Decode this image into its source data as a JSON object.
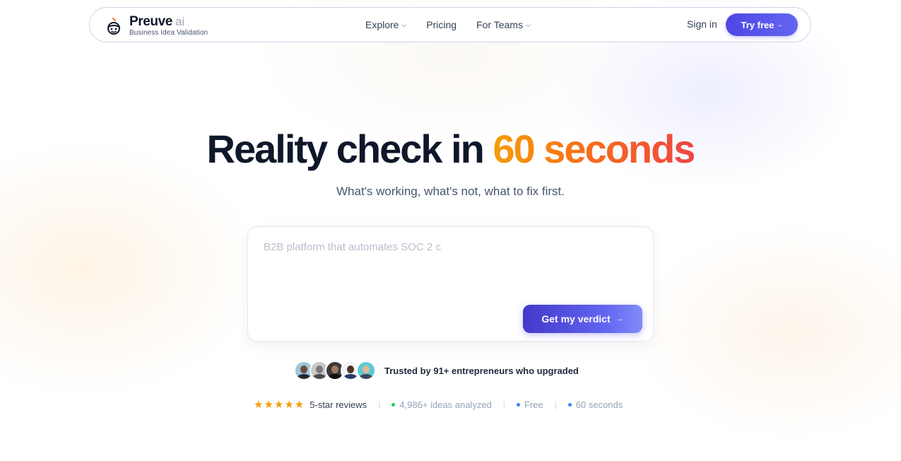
{
  "nav": {
    "brand_name": "Preuve",
    "brand_suffix": "ai",
    "brand_tagline": "Business Idea Validation",
    "links": [
      {
        "label": "Explore",
        "icon": "chevron-down-icon"
      },
      {
        "label": "Pricing"
      },
      {
        "label": "For Teams",
        "icon": "chevron-down-icon"
      }
    ],
    "sign_in": "Sign in",
    "try_free": "Try free",
    "try_free_arrow": "→"
  },
  "hero": {
    "title_main": "Reality check in",
    "title_accent": "60 seconds",
    "subtitle": "What's working, what's not, what to fix first.",
    "accent_colors": [
      "#f59e0b",
      "#f97316",
      "#ef4444"
    ]
  },
  "idea_form": {
    "placeholder": "B2B platform that automates SOC 2 c",
    "value": "",
    "submit_label": "Get my verdict",
    "submit_arrow": "→"
  },
  "social_proof": {
    "trusted_text": "Trusted by 91+ entrepreneurs who upgraded",
    "avatar_count": 5
  },
  "stats": {
    "rating_stars": 5,
    "reviews_label": "5-star reviews",
    "separator": "|",
    "items": [
      {
        "label": "4,986+ ideas analyzed",
        "dot_color": "#22c55e"
      },
      {
        "label": "Free",
        "dot_color": "#3b82f6"
      },
      {
        "label": "60 seconds",
        "dot_color": "#3b82f6"
      }
    ]
  },
  "colors": {
    "primary": "#4f46e5",
    "star": "#f59e0b",
    "text_dark": "#0f172a"
  }
}
